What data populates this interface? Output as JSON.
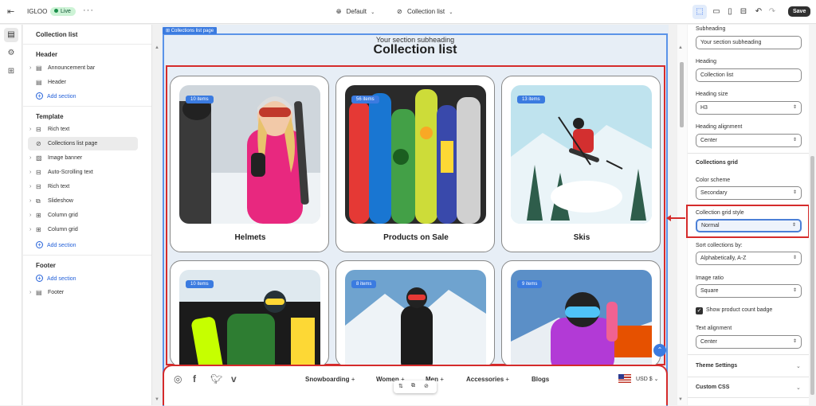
{
  "topbar": {
    "store_name": "IGLOO",
    "status": "Live",
    "theme": "Default",
    "page": "Collection list",
    "save_label": "Save"
  },
  "sidebar": {
    "title": "Collection list",
    "header_group": "Header",
    "header_items": [
      "Announcement bar",
      "Header"
    ],
    "add_section": "Add section",
    "template_group": "Template",
    "template_items": [
      "Rich text",
      "Collections list page",
      "Image banner",
      "Auto-Scrolling text",
      "Rich text",
      "Slideshow",
      "Column grid",
      "Column grid"
    ],
    "footer_group": "Footer",
    "footer_items": [
      "Footer"
    ]
  },
  "preview": {
    "section_tag": "Collections list page",
    "subheading": "Your section subheading",
    "heading": "Collection list",
    "collections": [
      {
        "title": "Helmets",
        "count": "10 items"
      },
      {
        "title": "Products on Sale",
        "count": "56 items"
      },
      {
        "title": "Skis",
        "count": "13 items"
      },
      {
        "title": "",
        "count": "10 items"
      },
      {
        "title": "",
        "count": "8 items"
      },
      {
        "title": "",
        "count": "9 items"
      }
    ],
    "footer_nav": [
      "Snowboarding",
      "Women",
      "Men",
      "Accessories",
      "Blogs"
    ],
    "currency": "USD $"
  },
  "settings": {
    "subheading_label": "Subheading",
    "subheading_value": "Your section subheading",
    "heading_label": "Heading",
    "heading_value": "Collection list",
    "heading_size_label": "Heading size",
    "heading_size_value": "H3",
    "heading_alignment_label": "Heading alignment",
    "heading_alignment_value": "Center",
    "collections_grid_group": "Collections grid",
    "color_scheme_label": "Color scheme",
    "color_scheme_value": "Secondary",
    "grid_style_label": "Collection grid style",
    "grid_style_value": "Normal",
    "sort_label": "Sort collections by:",
    "sort_value": "Alphabetically, A-Z",
    "image_ratio_label": "Image ratio",
    "image_ratio_value": "Square",
    "count_badge_label": "Show product count badge",
    "count_badge_checked": true,
    "text_alignment_label": "Text alignment",
    "text_alignment_value": "Center",
    "theme_settings": "Theme Settings",
    "custom_css": "Custom CSS"
  },
  "colors": {
    "accent": "#3b7be0",
    "highlight_red": "#d52b2b",
    "live_green": "#1a8e4a"
  }
}
